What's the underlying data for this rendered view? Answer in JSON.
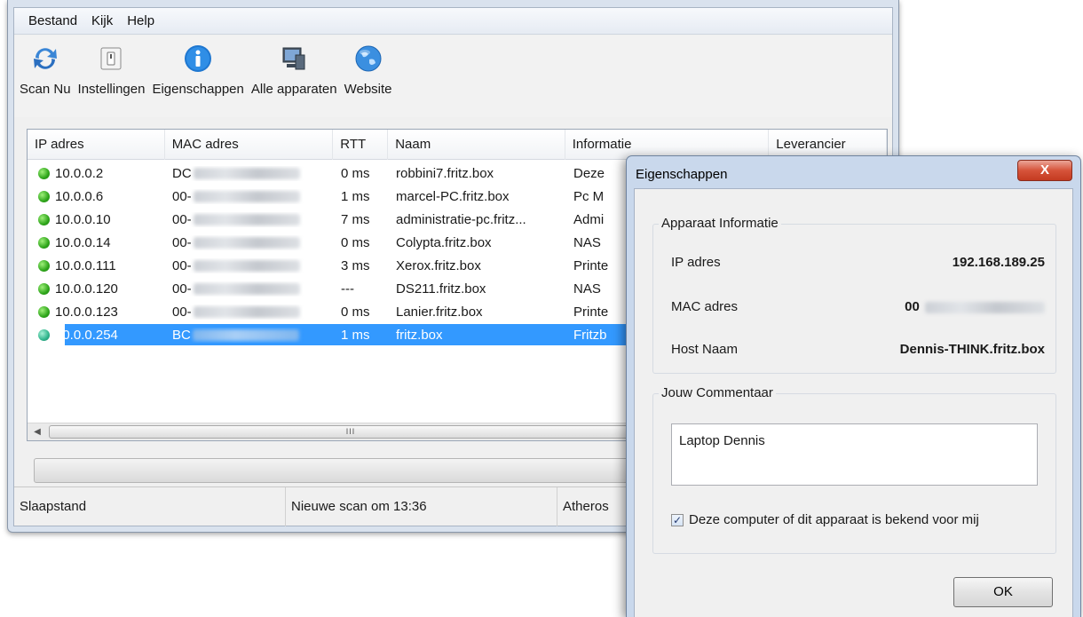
{
  "menu": [
    "Bestand",
    "Kijk",
    "Help"
  ],
  "toolbar": [
    {
      "label": "Scan Nu",
      "icon": "refresh-icon"
    },
    {
      "label": "Instellingen",
      "icon": "switch-icon"
    },
    {
      "label": "Eigenschappen",
      "icon": "info-icon"
    },
    {
      "label": "Alle apparaten",
      "icon": "devices-icon"
    },
    {
      "label": "Website",
      "icon": "globe-icon"
    }
  ],
  "table": {
    "columns": [
      "IP adres",
      "MAC adres",
      "RTT",
      "Naam",
      "Informatie",
      "Leverancier"
    ],
    "rows": [
      {
        "ip": "10.0.0.2",
        "mac": "DC",
        "rtt": "0 ms",
        "name": "robbini7.fritz.box",
        "info": "Deze",
        "status": "online"
      },
      {
        "ip": "10.0.0.6",
        "mac": "00-",
        "rtt": "1 ms",
        "name": "marcel-PC.fritz.box",
        "info": "Pc M",
        "status": "online"
      },
      {
        "ip": "10.0.0.10",
        "mac": "00-",
        "rtt": "7 ms",
        "name": "administratie-pc.fritz...",
        "info": "Admi",
        "status": "online"
      },
      {
        "ip": "10.0.0.14",
        "mac": "00-",
        "rtt": "0 ms",
        "name": "Colypta.fritz.box",
        "info": "NAS",
        "status": "online"
      },
      {
        "ip": "10.0.0.111",
        "mac": "00-",
        "rtt": "3 ms",
        "name": "Xerox.fritz.box",
        "info": "Printe",
        "status": "online"
      },
      {
        "ip": "10.0.0.120",
        "mac": "00-",
        "rtt": "---",
        "name": "DS211.fritz.box",
        "info": "NAS",
        "status": "online"
      },
      {
        "ip": "10.0.0.123",
        "mac": "00-",
        "rtt": "0 ms",
        "name": "Lanier.fritz.box",
        "info": "Printe",
        "status": "online"
      },
      {
        "ip": "10.0.0.254",
        "mac": "BC",
        "rtt": "1 ms",
        "name": "fritz.box",
        "info": "Fritzb",
        "status": "selected"
      }
    ]
  },
  "scrollbar": {
    "grip": "III"
  },
  "statusbar": [
    "Slaapstand",
    "Nieuwe scan om 13:36",
    "Atheros"
  ],
  "dialog": {
    "title": "Eigenschappen",
    "close_label": "X",
    "device_group": "Apparaat Informatie",
    "ip_label": "IP adres",
    "ip_value": "192.168.189.25",
    "mac_label": "MAC adres",
    "mac_value": "00",
    "host_label": "Host Naam",
    "host_value": "Dennis-THINK.fritz.box",
    "comment_group": "Jouw Commentaar",
    "comment_value": "Laptop Dennis",
    "known_checkbox": "Deze computer of dit apparaat is bekend voor mij",
    "known_checked": true,
    "ok_label": "OK"
  }
}
